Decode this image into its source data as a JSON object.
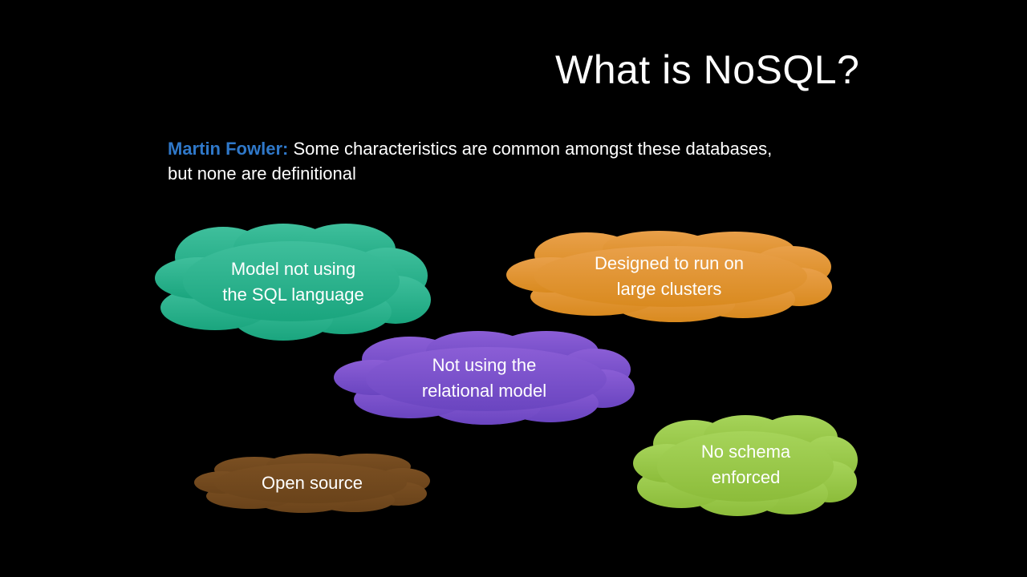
{
  "slide": {
    "title": "What is NoSQL?",
    "quote": {
      "author": "Martin Fowler:",
      "text": " Some characteristics are common amongst these databases, but none are definitional"
    }
  },
  "clouds": [
    {
      "id": "sql-language",
      "lines": [
        "Model not using",
        "the SQL language"
      ],
      "color_top": "#3fbf9c",
      "color_bottom": "#1aa57e"
    },
    {
      "id": "large-clusters",
      "lines": [
        "Designed to run on",
        "large clusters"
      ],
      "color_top": "#e9a04a",
      "color_bottom": "#d98a1f"
    },
    {
      "id": "relational-model",
      "lines": [
        "Not using the",
        "relational model"
      ],
      "color_top": "#8b5ed6",
      "color_bottom": "#6a45c0"
    },
    {
      "id": "no-schema",
      "lines": [
        "No schema",
        "enforced"
      ],
      "color_top": "#a6d45a",
      "color_bottom": "#8cbc3a"
    },
    {
      "id": "open-source",
      "lines": [
        "Open source"
      ],
      "color_top": "#7a4f22",
      "color_bottom": "#6a431a"
    }
  ]
}
